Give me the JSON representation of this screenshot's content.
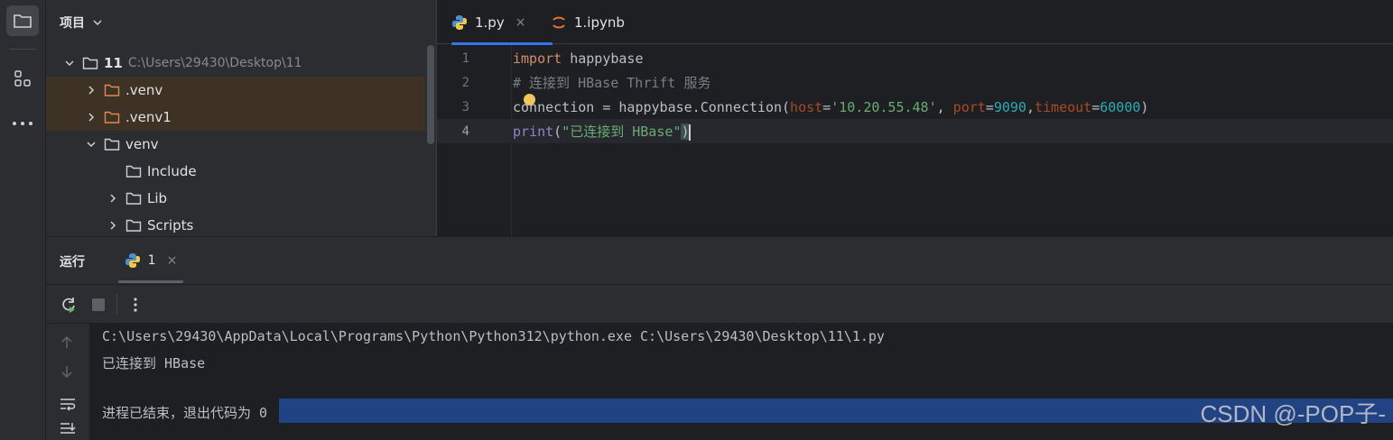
{
  "project_panel": {
    "title": "项目",
    "tree": [
      {
        "name": "11",
        "path": "C:\\Users\\29430\\Desktop\\11"
      },
      {
        "name": ".venv"
      },
      {
        "name": ".venv1"
      },
      {
        "name": "venv"
      },
      {
        "name": "Include"
      },
      {
        "name": "Lib"
      },
      {
        "name": "Scripts"
      }
    ]
  },
  "editor": {
    "tabs": [
      {
        "label": "1.py",
        "close": "×"
      },
      {
        "label": "1.ipynb"
      }
    ],
    "line_numbers": [
      "1",
      "2",
      "3",
      "4"
    ],
    "code": {
      "l1_kw": "import",
      "l1_rest": " happybase",
      "l2": "# 连接到 HBase Thrift 服务",
      "l3_a": "connection = happybase.Connection(",
      "l3_host_kw": "host",
      "l3_host_val": "'10.20.55.48'",
      "l3_sep1": ", ",
      "l3_port_kw": "port",
      "l3_port_val": "9090",
      "l3_sep2": ",",
      "l3_timeout_kw": "timeout",
      "l3_timeout_val": "60000",
      "l3_close": ")",
      "l4_fn": "print",
      "l4_open": "(",
      "l4_str": "\"已连接到 HBase\"",
      "l4_close": ")"
    }
  },
  "run_panel": {
    "title": "运行",
    "tab_label": "1",
    "tab_close": "×",
    "console_lines": [
      "C:\\Users\\29430\\AppData\\Local\\Programs\\Python\\Python312\\python.exe C:\\Users\\29430\\Desktop\\11\\1.py",
      "已连接到 HBase",
      "",
      "进程已结束，退出代码为 0"
    ]
  },
  "watermark": "CSDN @-POP子-",
  "colors": {
    "accent": "#3574f0",
    "excluded_bg": "#3d3223",
    "selection": "#214283"
  }
}
